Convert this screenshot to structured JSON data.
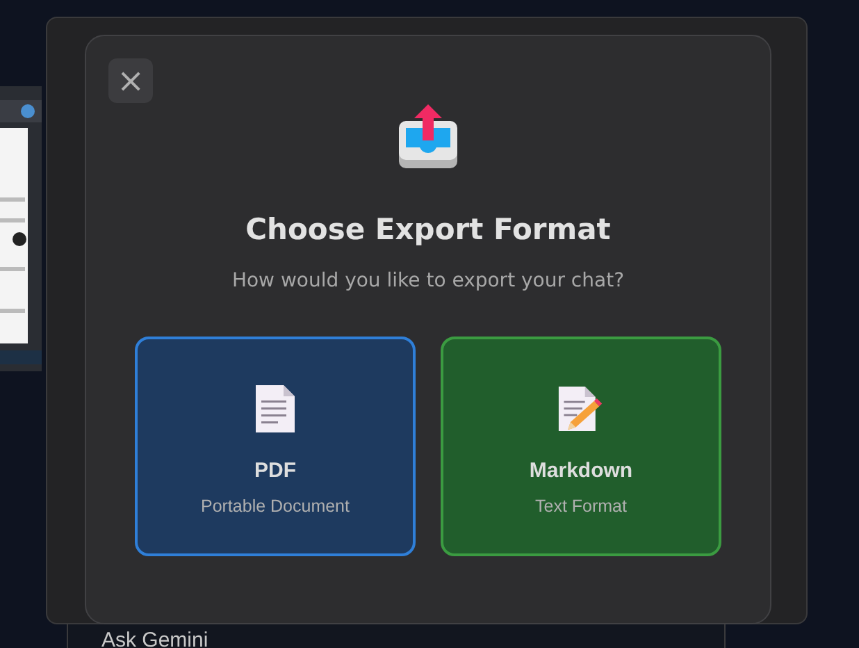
{
  "background": {
    "prompt_label": "Ask Gemini"
  },
  "dialog": {
    "close": "×",
    "title": "Choose Export Format",
    "subtitle": "How would you like to export your chat?",
    "options": [
      {
        "kind": "pdf",
        "title": "PDF",
        "description": "Portable Document",
        "color": "#2f7fd8"
      },
      {
        "kind": "markdown",
        "title": "Markdown",
        "description": "Text Format",
        "color": "#3b9b41"
      }
    ]
  }
}
